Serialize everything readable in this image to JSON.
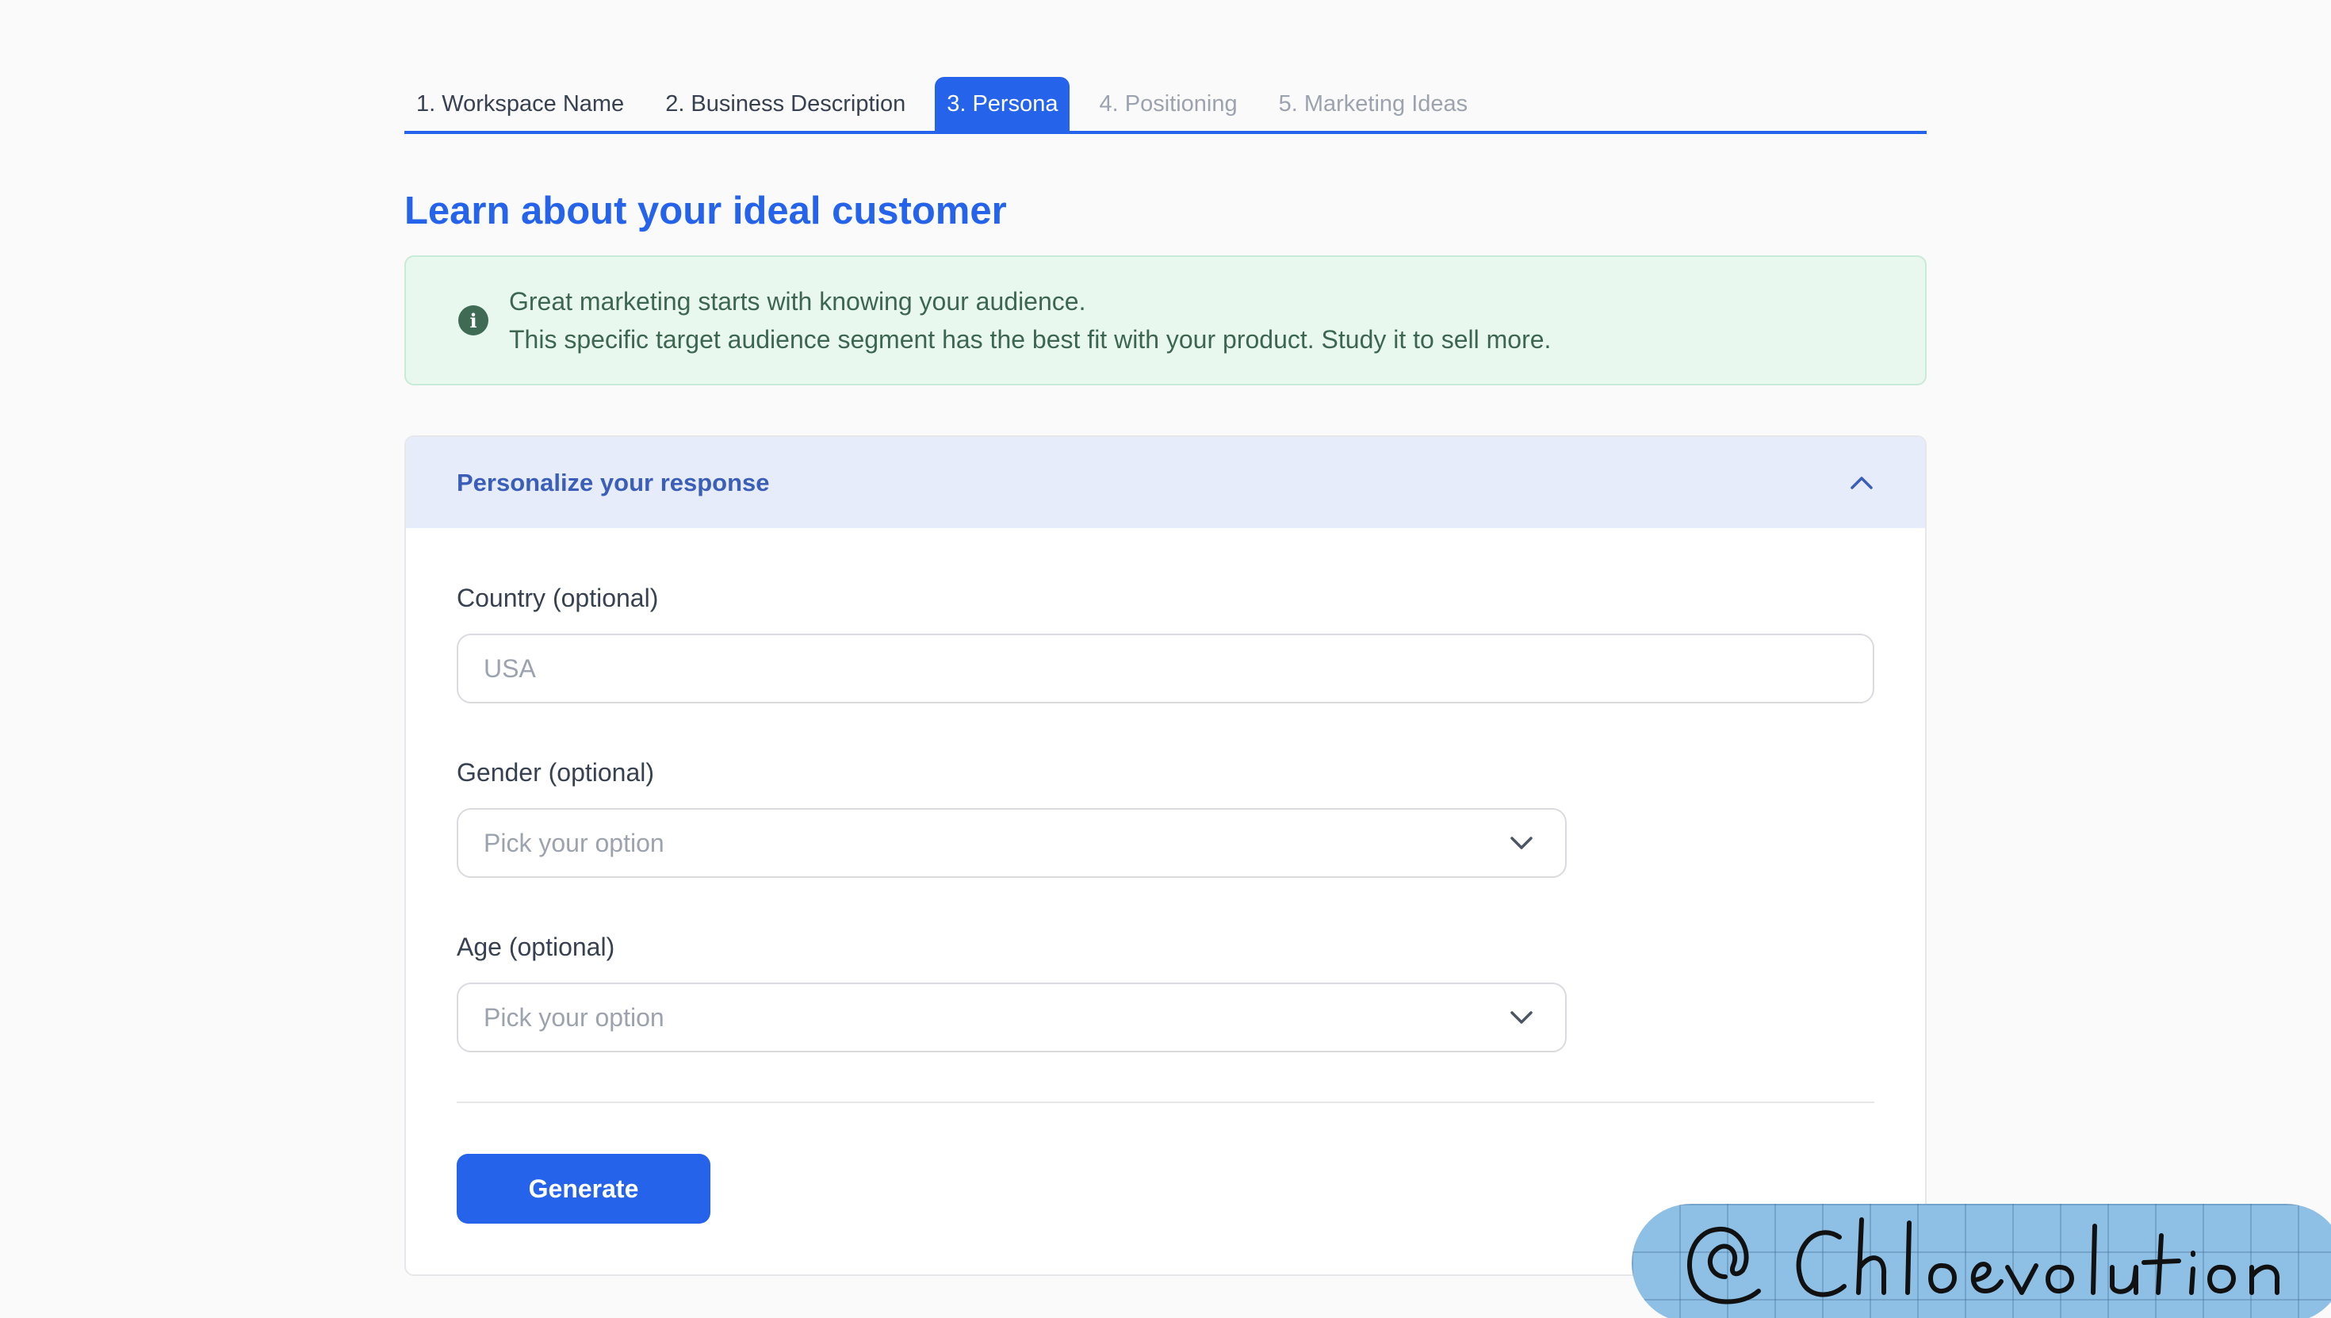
{
  "stepper": {
    "tabs": [
      {
        "label": "1. Workspace Name",
        "state": "done"
      },
      {
        "label": "2. Business Description",
        "state": "done"
      },
      {
        "label": "3. Persona",
        "state": "active"
      },
      {
        "label": "4. Positioning",
        "state": "disabled"
      },
      {
        "label": "5. Marketing Ideas",
        "state": "disabled"
      }
    ]
  },
  "page": {
    "title": "Learn about your ideal customer"
  },
  "info": {
    "icon": "info-icon",
    "line1": "Great marketing starts with knowing your audience.",
    "line2": "This specific target audience segment has the best fit with your product. Study it to sell more."
  },
  "personalize": {
    "header": "Personalize your response",
    "expanded": true,
    "country": {
      "label": "Country (optional)",
      "placeholder": "USA",
      "value": ""
    },
    "gender": {
      "label": "Gender (optional)",
      "selected": "Pick your option"
    },
    "age": {
      "label": "Age (optional)",
      "selected": "Pick your option"
    },
    "generate_label": "Generate"
  },
  "watermark": {
    "text": "@ Chloevolution"
  },
  "colors": {
    "accent": "#2563eb",
    "info_bg": "#e8f8ef",
    "info_text": "#3d6651",
    "header_bg": "#e6ecfa"
  }
}
